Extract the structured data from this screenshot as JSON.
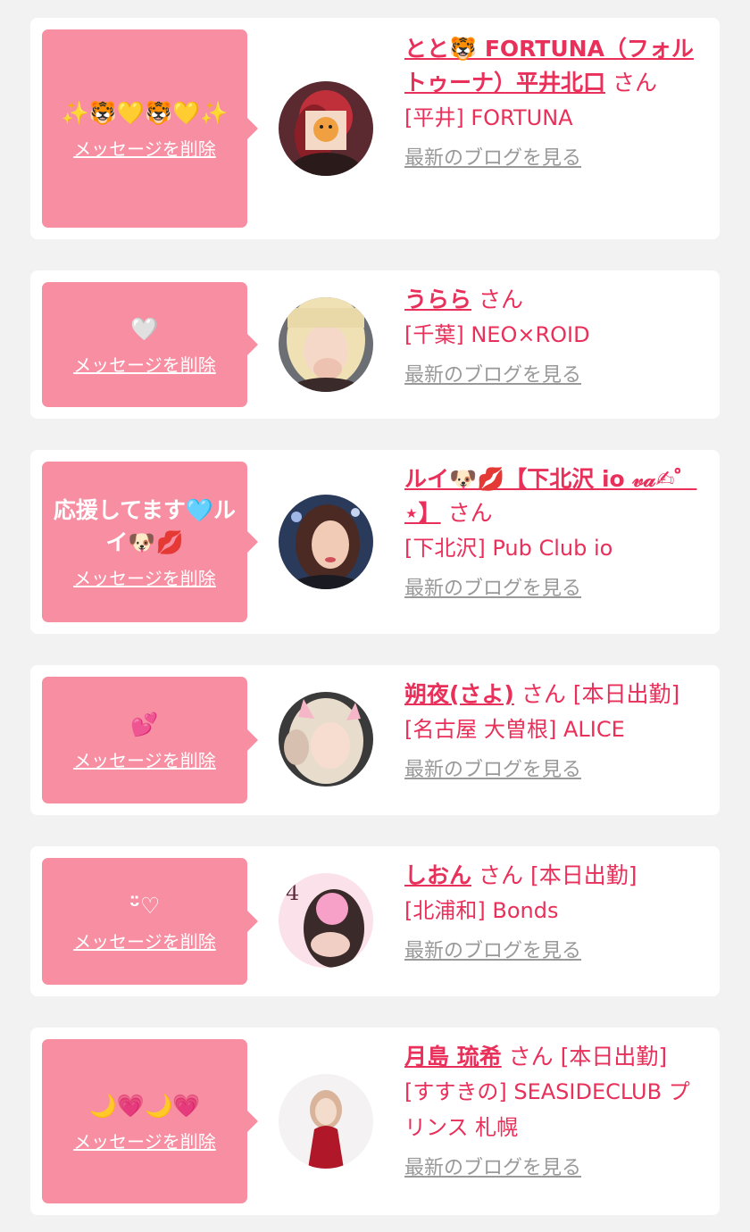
{
  "delete_label": "メッセージを削除",
  "honorific": "さん",
  "blog_label": "最新のブログを見る",
  "colors": {
    "accent_pink": "#e8305a",
    "bubble_pink": "#f78ea2",
    "card_bg": "#ffffff",
    "page_bg": "#f2f2f2",
    "link_gray": "#999999"
  },
  "cards": [
    {
      "message": "✨🐯💛🐯💛✨",
      "name": "とと🐯 FORTUNA（フォルトゥーナ）平井北口",
      "work": "",
      "shop": "[平井] FORTUNA"
    },
    {
      "message": "🤍",
      "name": "うらら",
      "work": "",
      "shop": "[千葉] NEO×ROID"
    },
    {
      "message": "応援してます🩵ルイ🐶💋",
      "name": "ルイ🐶💋【下北沢 io 𝓋𝒶✍︎゜⋆】",
      "work": "",
      "shop": "[下北沢] Pub Club io"
    },
    {
      "message": "💕",
      "name": "朔夜(さよ)",
      "work": "[本日出勤]",
      "shop": "[名古屋 大曽根] ALICE"
    },
    {
      "message": "ᵕ̈♡",
      "name": "しおん",
      "work": "[本日出勤]",
      "shop": "[北浦和] Bonds"
    },
    {
      "message": "🌙💗🌙💗",
      "name": "月島 琉希",
      "work": "[本日出勤]",
      "shop": "[すすきの] SEASIDECLUB プリンス 札幌"
    }
  ]
}
